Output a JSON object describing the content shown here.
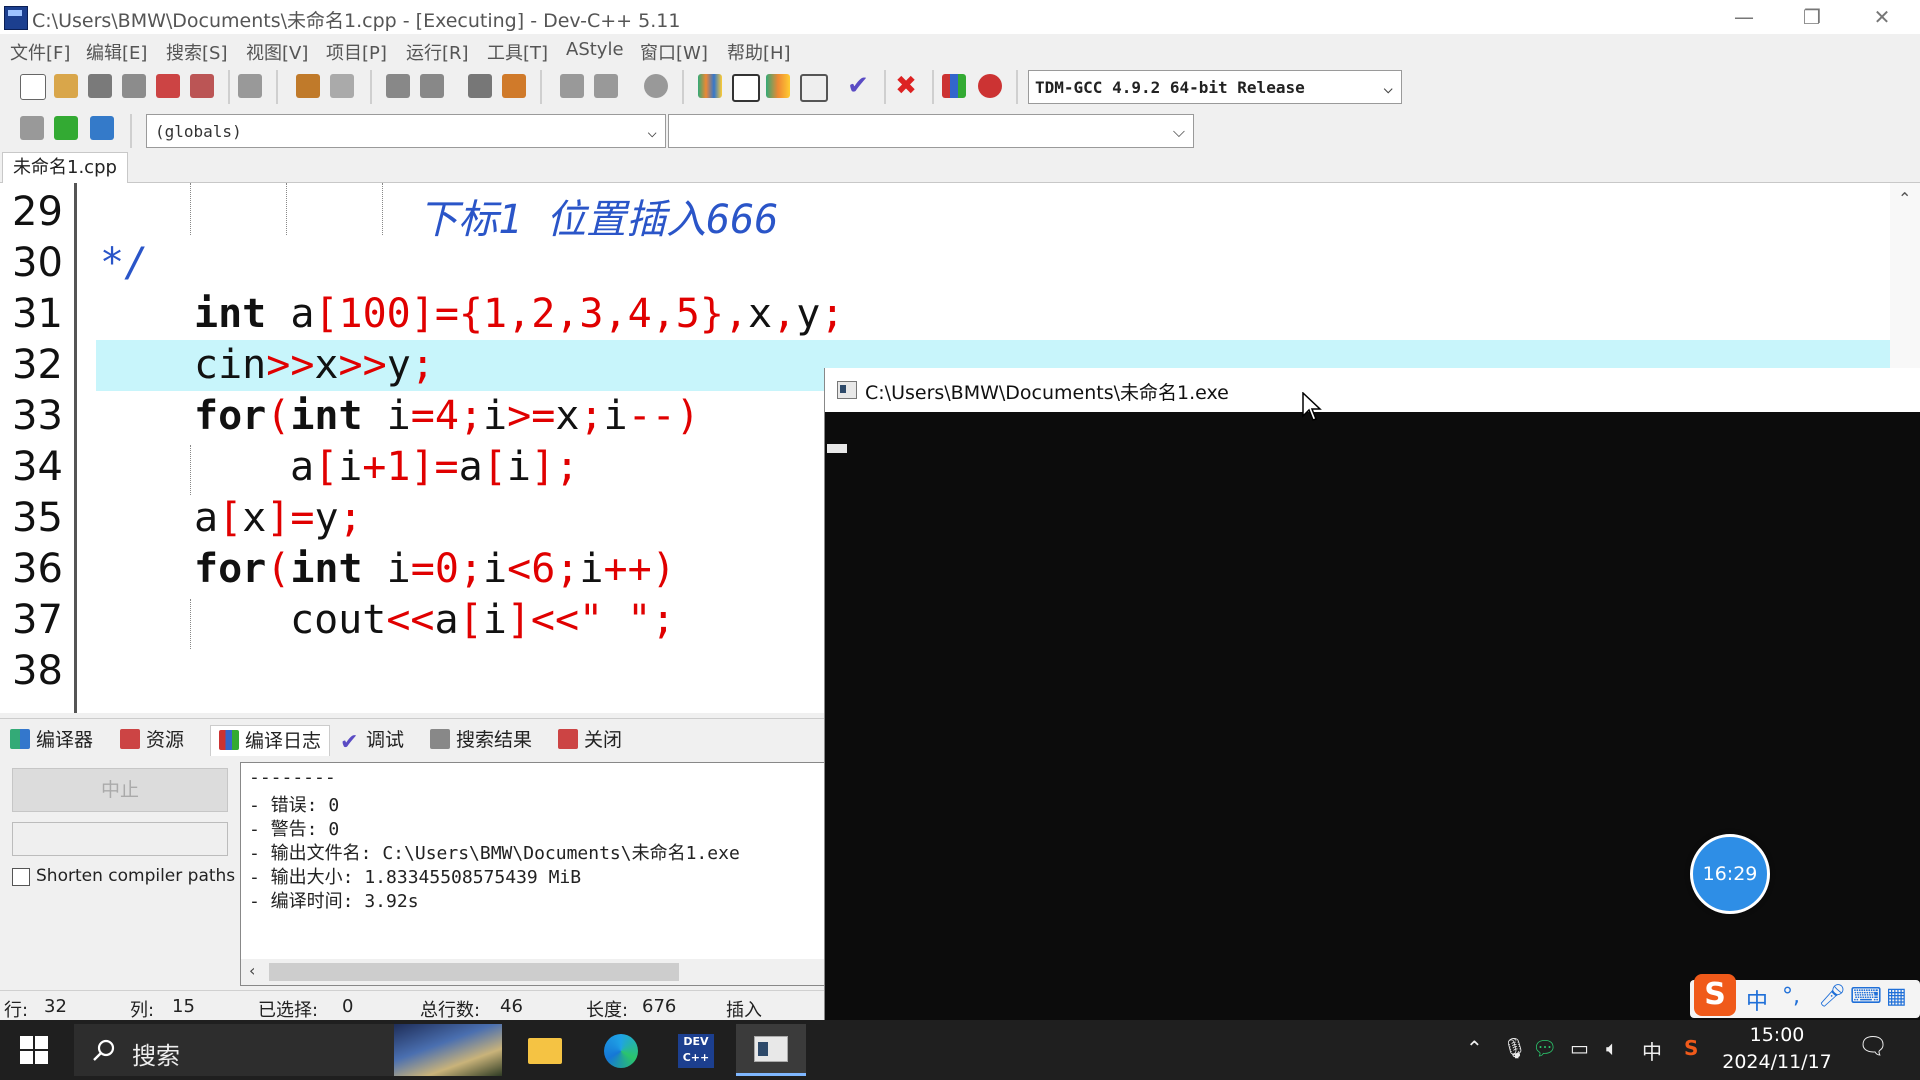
{
  "window": {
    "title": "C:\\Users\\BMW\\Documents\\未命名1.cpp - [Executing] - Dev-C++ 5.11",
    "minimize": "—",
    "restore": "❐",
    "close": "✕"
  },
  "menu": [
    "文件[F]",
    "编辑[E]",
    "搜索[S]",
    "视图[V]",
    "项目[P]",
    "运行[R]",
    "工具[T]",
    "AStyle",
    "窗口[W]",
    "帮助[H]"
  ],
  "toolbar": {
    "compiler": "TDM-GCC 4.9.2 64-bit Release",
    "scope": "(globals)"
  },
  "editor": {
    "tab": "未命名1.cpp",
    "lines": [
      {
        "n": "29"
      },
      {
        "n": "30"
      },
      {
        "n": "31"
      },
      {
        "n": "32"
      },
      {
        "n": "33"
      },
      {
        "n": "34"
      },
      {
        "n": "35"
      },
      {
        "n": "36"
      },
      {
        "n": "37"
      },
      {
        "n": "38"
      }
    ],
    "comment_text": "下标1 位置插入666",
    "comment_end": "*/"
  },
  "bottom_tabs": [
    "编译器",
    "资源",
    "编译日志",
    "调试",
    "搜索结果",
    "关闭"
  ],
  "compile_panel": {
    "abort": "中止",
    "shorten_label": "Shorten compiler paths",
    "log": [
      "--------",
      "- 错误: 0",
      "- 警告: 0",
      "- 输出文件名: C:\\Users\\BMW\\Documents\\未命名1.exe",
      "- 输出大小: 1.83345508575439 MiB",
      "- 编译时间: 3.92s"
    ]
  },
  "status": {
    "row_label": "行:",
    "row": "32",
    "col_label": "列:",
    "col": "15",
    "sel_label": "已选择:",
    "sel": "0",
    "lines_label": "总行数:",
    "lines": "46",
    "len_label": "长度:",
    "len": "676",
    "mode": "插入"
  },
  "console": {
    "title": "C:\\Users\\BMW\\Documents\\未命名1.exe"
  },
  "timer": "16:29",
  "ime": {
    "lang": "中",
    "punct": "°,"
  },
  "taskbar": {
    "search": "搜索",
    "tray_lang": "中",
    "time": "15:00",
    "date": "2024/11/17"
  }
}
